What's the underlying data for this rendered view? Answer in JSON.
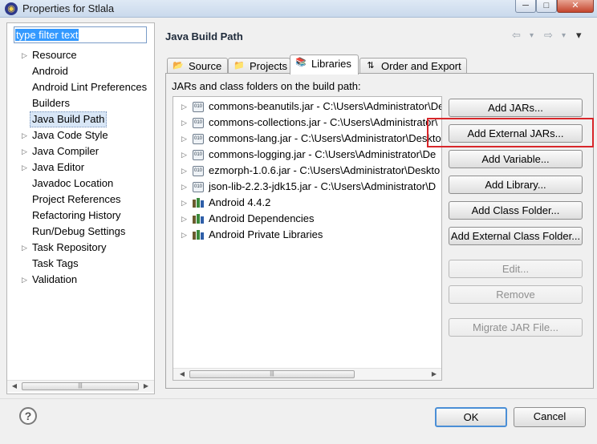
{
  "window": {
    "title": "Properties for Stlala",
    "app_icon": "eclipse-icon",
    "controls": {
      "minimize": "─",
      "maximize": "□",
      "close": "✕"
    }
  },
  "filter": {
    "placeholder": "type filter text",
    "value": "type filter text"
  },
  "nav_tree": {
    "items": [
      {
        "label": "Resource",
        "expandable": true
      },
      {
        "label": "Android",
        "expandable": false
      },
      {
        "label": "Android Lint Preferences",
        "expandable": false
      },
      {
        "label": "Builders",
        "expandable": false
      },
      {
        "label": "Java Build Path",
        "expandable": false,
        "selected": true
      },
      {
        "label": "Java Code Style",
        "expandable": true
      },
      {
        "label": "Java Compiler",
        "expandable": true
      },
      {
        "label": "Java Editor",
        "expandable": true
      },
      {
        "label": "Javadoc Location",
        "expandable": false
      },
      {
        "label": "Project References",
        "expandable": false
      },
      {
        "label": "Refactoring History",
        "expandable": false
      },
      {
        "label": "Run/Debug Settings",
        "expandable": false
      },
      {
        "label": "Task Repository",
        "expandable": true
      },
      {
        "label": "Task Tags",
        "expandable": false
      },
      {
        "label": "Validation",
        "expandable": true
      }
    ]
  },
  "page": {
    "title": "Java Build Path",
    "nav_icons": {
      "back": "⇦",
      "back_menu": "▾",
      "forward": "⇨",
      "forward_menu": "▾",
      "view_menu": "▾"
    }
  },
  "tabs": [
    {
      "label": "Source",
      "icon": "folder-source-icon",
      "active": false
    },
    {
      "label": "Projects",
      "icon": "projects-icon",
      "active": false
    },
    {
      "label": "Libraries",
      "icon": "libraries-icon",
      "active": true
    },
    {
      "label": "Order and Export",
      "icon": "order-export-icon",
      "active": false
    }
  ],
  "libraries": {
    "section_label": "JARs and class folders on the build path:",
    "entries": [
      {
        "label": "commons-beanutils.jar - C:\\Users\\Administrator\\De",
        "icon": "jar-icon"
      },
      {
        "label": "commons-collections.jar - C:\\Users\\Administrator\\",
        "icon": "jar-icon"
      },
      {
        "label": "commons-lang.jar - C:\\Users\\Administrator\\Deskto",
        "icon": "jar-icon"
      },
      {
        "label": "commons-logging.jar - C:\\Users\\Administrator\\De",
        "icon": "jar-icon"
      },
      {
        "label": "ezmorph-1.0.6.jar - C:\\Users\\Administrator\\Deskto",
        "icon": "jar-icon"
      },
      {
        "label": "json-lib-2.2.3-jdk15.jar - C:\\Users\\Administrator\\D",
        "icon": "jar-icon"
      },
      {
        "label": "Android 4.4.2",
        "icon": "library-icon"
      },
      {
        "label": "Android Dependencies",
        "icon": "library-icon"
      },
      {
        "label": "Android Private Libraries",
        "icon": "library-icon"
      }
    ],
    "jar_icon_text": "010"
  },
  "buttons": {
    "add_jars": "Add JARs...",
    "add_external_jars": "Add External JARs...",
    "add_variable": "Add Variable...",
    "add_library": "Add Library...",
    "add_class_folder": "Add Class Folder...",
    "add_external_class_folder": "Add External Class Folder...",
    "edit": "Edit...",
    "remove": "Remove",
    "migrate_jar": "Migrate JAR File...",
    "ok": "OK",
    "cancel": "Cancel"
  },
  "colors": {
    "highlight": "#d8262a",
    "selection": "#3399ff",
    "ok_border": "#4b8fd6"
  }
}
